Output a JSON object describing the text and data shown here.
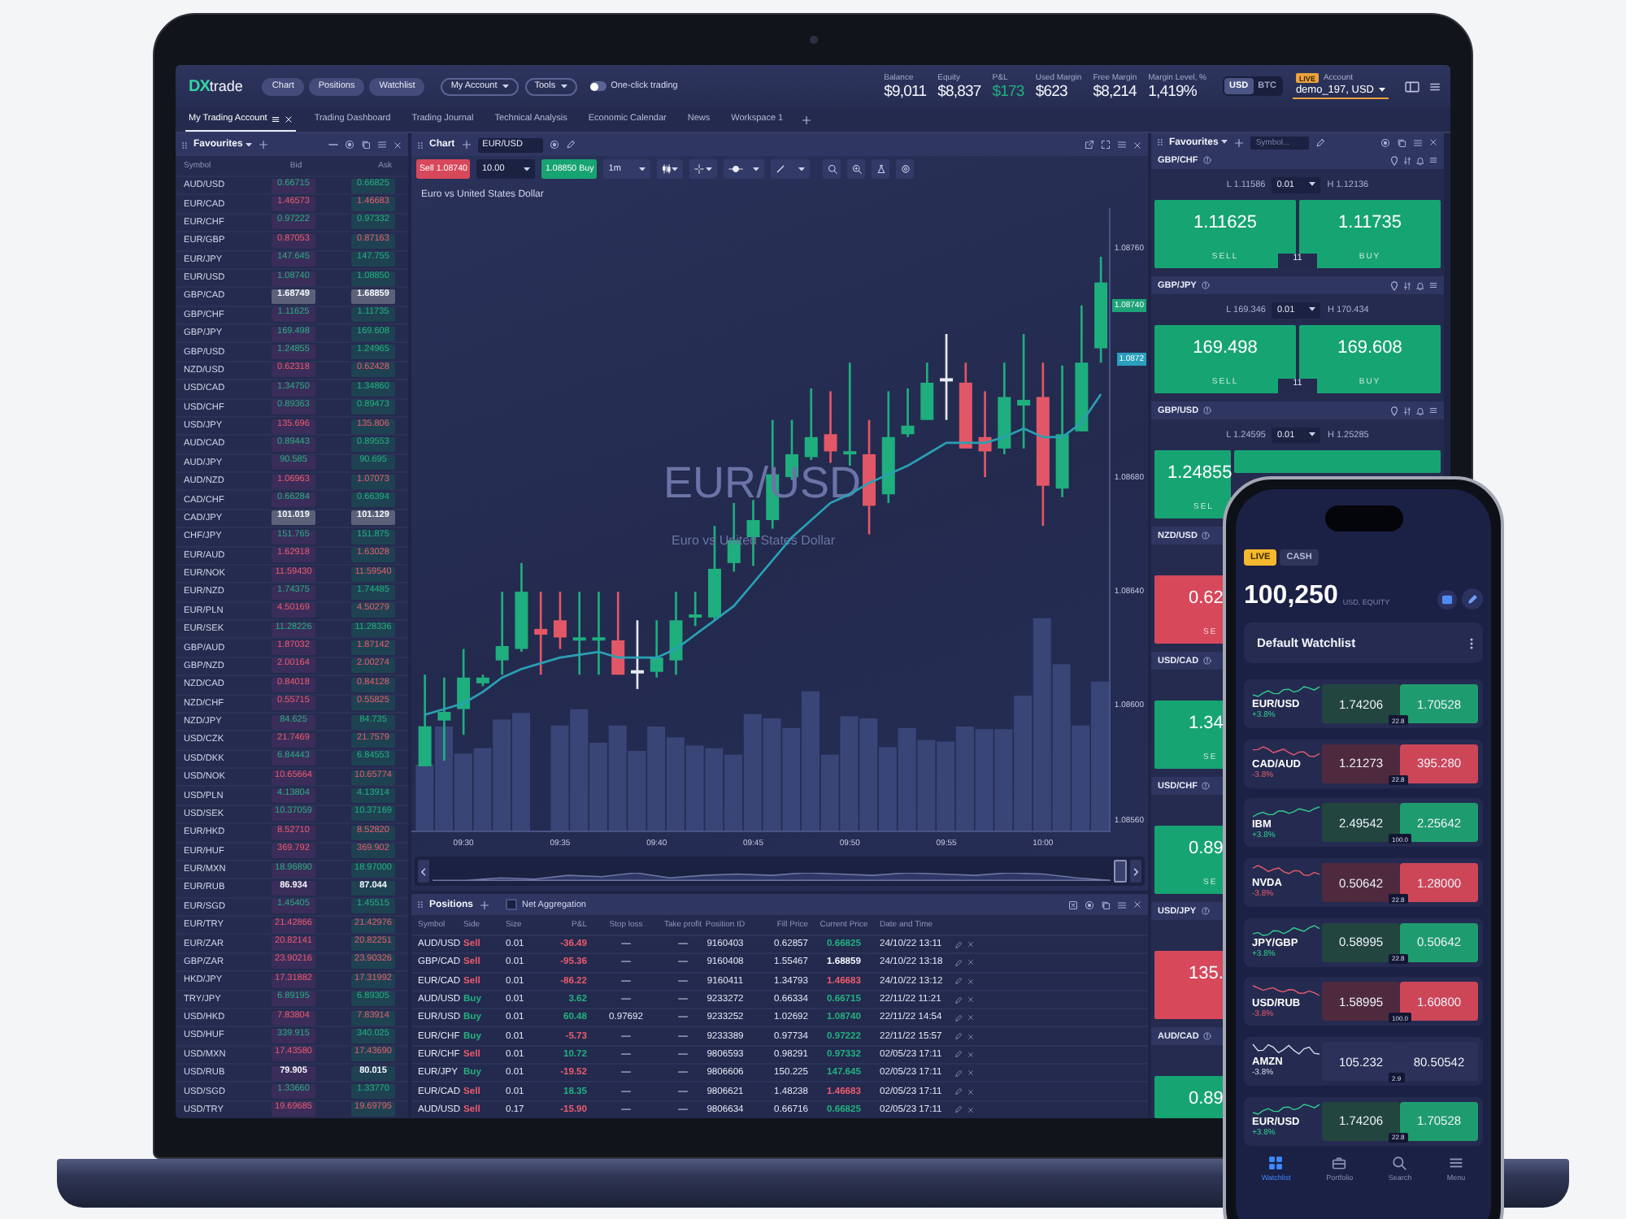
{
  "top_bar": {
    "logo": {
      "mark": "DX",
      "name": "trade"
    },
    "nav_buttons": [
      "Chart",
      "Positions",
      "Watchlist"
    ],
    "menus": [
      "My Account",
      "Tools"
    ],
    "one_click": {
      "label": "One-click trading",
      "on": false
    },
    "stats": [
      {
        "label": "Balance",
        "value": "$9,011",
        "color": "#f4f6fc"
      },
      {
        "label": "Equity",
        "value": "$8,837",
        "color": "#f4f6fc"
      },
      {
        "label": "P&L",
        "value": "$173",
        "color": "#22b07e"
      },
      {
        "label": "Used Margin",
        "value": "$623",
        "color": "#f4f6fc"
      },
      {
        "label": "Free Margin",
        "value": "$8,214",
        "color": "#f4f6fc"
      },
      {
        "label": "Margin Level, %",
        "value": "1,419%",
        "color": "#f4f6fc"
      }
    ],
    "currencies": [
      {
        "label": "USD",
        "selected": true
      },
      {
        "label": "BTC",
        "selected": false
      }
    ],
    "account": {
      "badge": "LIVE",
      "label": "Account",
      "value": "demo_197, USD"
    }
  },
  "tabs": [
    {
      "label": "My Trading Account",
      "selected": true
    },
    {
      "label": "Trading Dashboard",
      "selected": false
    },
    {
      "label": "Trading Journal",
      "selected": false
    },
    {
      "label": "Technical Analysis",
      "selected": false
    },
    {
      "label": "Economic Calendar",
      "selected": false
    },
    {
      "label": "News",
      "selected": false
    },
    {
      "label": "Workspace 1",
      "selected": false
    }
  ],
  "watchlist": {
    "title": "Favourites",
    "columns": [
      "Symbol",
      "Bid",
      "Ask"
    ],
    "rows": [
      {
        "symbol": "AUD/USD",
        "bid": "0.66715",
        "ask": "0.66825",
        "kind": "up",
        "highlighted": false
      },
      {
        "symbol": "EUR/CAD",
        "bid": "1.46573",
        "ask": "1.46683",
        "kind": "down",
        "highlighted": false
      },
      {
        "symbol": "EUR/CHF",
        "bid": "0.97222",
        "ask": "0.97332",
        "kind": "up",
        "highlighted": false
      },
      {
        "symbol": "EUR/GBP",
        "bid": "0.87053",
        "ask": "0.87163",
        "kind": "down",
        "highlighted": false
      },
      {
        "symbol": "EUR/JPY",
        "bid": "147.645",
        "ask": "147.755",
        "kind": "up",
        "highlighted": false
      },
      {
        "symbol": "EUR/USD",
        "bid": "1.08740",
        "ask": "1.08850",
        "kind": "up",
        "highlighted": false
      },
      {
        "symbol": "GBP/CAD",
        "bid": "1.68749",
        "ask": "1.68859",
        "kind": "flat",
        "highlighted": true
      },
      {
        "symbol": "GBP/CHF",
        "bid": "1.11625",
        "ask": "1.11735",
        "kind": "up",
        "highlighted": false
      },
      {
        "symbol": "GBP/JPY",
        "bid": "169.498",
        "ask": "169.608",
        "kind": "up",
        "highlighted": false
      },
      {
        "symbol": "GBP/USD",
        "bid": "1.24855",
        "ask": "1.24965",
        "kind": "up",
        "highlighted": false
      },
      {
        "symbol": "NZD/USD",
        "bid": "0.62318",
        "ask": "0.62428",
        "kind": "down",
        "highlighted": false
      },
      {
        "symbol": "USD/CAD",
        "bid": "1.34750",
        "ask": "1.34860",
        "kind": "up",
        "highlighted": false
      },
      {
        "symbol": "USD/CHF",
        "bid": "0.89363",
        "ask": "0.89473",
        "kind": "up",
        "highlighted": false
      },
      {
        "symbol": "USD/JPY",
        "bid": "135.696",
        "ask": "135.806",
        "kind": "down",
        "highlighted": false
      },
      {
        "symbol": "AUD/CAD",
        "bid": "0.89443",
        "ask": "0.89553",
        "kind": "up",
        "highlighted": false
      },
      {
        "symbol": "AUD/JPY",
        "bid": "90.585",
        "ask": "90.695",
        "kind": "up",
        "highlighted": false
      },
      {
        "symbol": "AUD/NZD",
        "bid": "1.06963",
        "ask": "1.07073",
        "kind": "down",
        "highlighted": false
      },
      {
        "symbol": "CAD/CHF",
        "bid": "0.66284",
        "ask": "0.66394",
        "kind": "up",
        "highlighted": false
      },
      {
        "symbol": "CAD/JPY",
        "bid": "101.019",
        "ask": "101.129",
        "kind": "flat",
        "highlighted": true
      },
      {
        "symbol": "CHF/JPY",
        "bid": "151.765",
        "ask": "151.875",
        "kind": "up",
        "highlighted": false
      },
      {
        "symbol": "EUR/AUD",
        "bid": "1.62918",
        "ask": "1.63028",
        "kind": "down",
        "highlighted": false
      },
      {
        "symbol": "EUR/NOK",
        "bid": "11.59430",
        "ask": "11.59540",
        "kind": "down",
        "highlighted": false
      },
      {
        "symbol": "EUR/NZD",
        "bid": "1.74375",
        "ask": "1.74485",
        "kind": "up",
        "highlighted": false
      },
      {
        "symbol": "EUR/PLN",
        "bid": "4.50169",
        "ask": "4.50279",
        "kind": "down",
        "highlighted": false
      },
      {
        "symbol": "EUR/SEK",
        "bid": "11.28226",
        "ask": "11.28336",
        "kind": "up",
        "highlighted": false
      },
      {
        "symbol": "GBP/AUD",
        "bid": "1.87032",
        "ask": "1.87142",
        "kind": "down",
        "highlighted": false
      },
      {
        "symbol": "GBP/NZD",
        "bid": "2.00164",
        "ask": "2.00274",
        "kind": "down",
        "highlighted": false
      },
      {
        "symbol": "NZD/CAD",
        "bid": "0.84018",
        "ask": "0.84128",
        "kind": "down",
        "highlighted": false
      },
      {
        "symbol": "NZD/CHF",
        "bid": "0.55715",
        "ask": "0.55825",
        "kind": "down",
        "highlighted": false
      },
      {
        "symbol": "NZD/JPY",
        "bid": "84.625",
        "ask": "84.735",
        "kind": "up",
        "highlighted": false
      },
      {
        "symbol": "USD/CZK",
        "bid": "21.7469",
        "ask": "21.7579",
        "kind": "down",
        "highlighted": false
      },
      {
        "symbol": "USD/DKK",
        "bid": "6.84443",
        "ask": "6.84553",
        "kind": "up",
        "highlighted": false
      },
      {
        "symbol": "USD/NOK",
        "bid": "10.65664",
        "ask": "10.65774",
        "kind": "down",
        "highlighted": false
      },
      {
        "symbol": "USD/PLN",
        "bid": "4.13804",
        "ask": "4.13914",
        "kind": "up",
        "highlighted": false
      },
      {
        "symbol": "USD/SEK",
        "bid": "10.37059",
        "ask": "10.37169",
        "kind": "up",
        "highlighted": false
      },
      {
        "symbol": "EUR/HKD",
        "bid": "8.52710",
        "ask": "8.52820",
        "kind": "down",
        "highlighted": false
      },
      {
        "symbol": "EUR/HUF",
        "bid": "369.792",
        "ask": "369.902",
        "kind": "down",
        "highlighted": false
      },
      {
        "symbol": "EUR/MXN",
        "bid": "18.96890",
        "ask": "18.97000",
        "kind": "up",
        "highlighted": false
      },
      {
        "symbol": "EUR/RUB",
        "bid": "86.934",
        "ask": "87.044",
        "kind": "flat",
        "highlighted": false
      },
      {
        "symbol": "EUR/SGD",
        "bid": "1.45405",
        "ask": "1.45515",
        "kind": "up",
        "highlighted": false
      },
      {
        "symbol": "EUR/TRY",
        "bid": "21.42866",
        "ask": "21.42976",
        "kind": "down",
        "highlighted": false
      },
      {
        "symbol": "EUR/ZAR",
        "bid": "20.82141",
        "ask": "20.82251",
        "kind": "down",
        "highlighted": false
      },
      {
        "symbol": "GBP/ZAR",
        "bid": "23.90216",
        "ask": "23.90326",
        "kind": "down",
        "highlighted": false
      },
      {
        "symbol": "HKD/JPY",
        "bid": "17.31882",
        "ask": "17.31992",
        "kind": "down",
        "highlighted": false
      },
      {
        "symbol": "TRY/JPY",
        "bid": "6.89195",
        "ask": "6.89305",
        "kind": "up",
        "highlighted": false
      },
      {
        "symbol": "USD/HKD",
        "bid": "7.83804",
        "ask": "7.83914",
        "kind": "down",
        "highlighted": false
      },
      {
        "symbol": "USD/HUF",
        "bid": "339.915",
        "ask": "340.025",
        "kind": "up",
        "highlighted": false
      },
      {
        "symbol": "USD/MXN",
        "bid": "17.43580",
        "ask": "17.43690",
        "kind": "down",
        "highlighted": false
      },
      {
        "symbol": "USD/RUB",
        "bid": "79.905",
        "ask": "80.015",
        "kind": "flat",
        "highlighted": false
      },
      {
        "symbol": "USD/SGD",
        "bid": "1.33660",
        "ask": "1.33770",
        "kind": "up",
        "highlighted": false
      },
      {
        "symbol": "USD/TRY",
        "bid": "19.69685",
        "ask": "19.69795",
        "kind": "down",
        "highlighted": false
      }
    ]
  },
  "chart": {
    "title": "Chart",
    "symbol": "EUR/USD",
    "sell": {
      "label": "Sell",
      "price": "1.08740"
    },
    "quantity": "10.00",
    "buy": {
      "price": "1.08850",
      "label": "Buy"
    },
    "timeframe": "1m",
    "description": "Euro vs United States Dollar",
    "watermark": {
      "symbol": "EUR/USD",
      "description": "Euro vs United States Dollar"
    },
    "price_badges": [
      {
        "text": "1.08740",
        "kind": "last"
      },
      {
        "text": "1.0872",
        "kind": "average"
      }
    ],
    "chart_data": {
      "type": "candlestick",
      "x": [
        568,
        569,
        570,
        571,
        572,
        573,
        574,
        575,
        576,
        577,
        578,
        579,
        580,
        581,
        582,
        583,
        584,
        585,
        586,
        587,
        588,
        589,
        590,
        591,
        592,
        593,
        594,
        595,
        596,
        597,
        598,
        599,
        600,
        601,
        602,
        603
      ],
      "ohlc": [
        [
          1.08579,
          1.08611,
          1.08579,
          1.08593
        ],
        [
          1.08595,
          1.0861,
          1.08581,
          1.08598
        ],
        [
          1.08599,
          1.0862,
          1.0859,
          1.0861
        ],
        [
          1.08608,
          1.08611,
          1.08607,
          1.0861
        ],
        [
          1.08616,
          1.0864,
          1.08611,
          1.08621
        ],
        [
          1.0862,
          1.0865,
          1.08619,
          1.0864
        ],
        [
          1.08627,
          1.0864,
          1.08611,
          1.08625
        ],
        [
          1.0863,
          1.0864,
          1.0862,
          1.08624
        ],
        [
          1.08623,
          1.0864,
          1.08611,
          1.08624
        ],
        [
          1.08623,
          1.0864,
          1.08611,
          1.08624
        ],
        [
          1.08623,
          1.0864,
          1.08611,
          1.08611
        ],
        [
          1.08612,
          1.0863,
          1.08606,
          1.08612
        ],
        [
          1.08612,
          1.0863,
          1.0861,
          1.08617
        ],
        [
          1.08616,
          1.0864,
          1.08611,
          1.0863
        ],
        [
          1.08631,
          1.0864,
          1.08628,
          1.08632
        ],
        [
          1.08631,
          1.08663,
          1.0863,
          1.08648
        ],
        [
          1.0865,
          1.08671,
          1.08647,
          1.08658
        ],
        [
          1.08659,
          1.08672,
          1.08649,
          1.08665
        ],
        [
          1.08665,
          1.087,
          1.08662,
          1.08681
        ],
        [
          1.0868,
          1.087,
          1.08679,
          1.08688
        ],
        [
          1.08687,
          1.08711,
          1.08686,
          1.08694
        ],
        [
          1.08695,
          1.0871,
          1.08685,
          1.08689
        ],
        [
          1.08688,
          1.0872,
          1.08684,
          1.08689
        ],
        [
          1.08688,
          1.087,
          1.0866,
          1.0867
        ],
        [
          1.08674,
          1.0871,
          1.08671,
          1.08694
        ],
        [
          1.08695,
          1.08711,
          1.08694,
          1.08698
        ],
        [
          1.087,
          1.0872,
          1.087,
          1.08713
        ],
        [
          1.08714,
          1.0873,
          1.087,
          1.08714
        ],
        [
          1.08713,
          1.0872,
          1.0869,
          1.0869
        ],
        [
          1.08694,
          1.0871,
          1.0868,
          1.08689
        ],
        [
          1.0869,
          1.0872,
          1.08688,
          1.08708
        ],
        [
          1.08705,
          1.0873,
          1.0869,
          1.08707
        ],
        [
          1.08708,
          1.0872,
          1.08663,
          1.08677
        ],
        [
          1.08676,
          1.08719,
          1.08673,
          1.08695
        ],
        [
          1.08696,
          1.0874,
          1.08696,
          1.0872
        ],
        [
          1.08725,
          1.08757,
          1.0872,
          1.08748
        ]
      ],
      "series": [
        {
          "type": "line",
          "color": "#2aa0b4",
          "values": [
            1.08597,
            1.08599,
            1.08601,
            1.08605,
            1.0861,
            1.08613,
            1.08615,
            1.08617,
            1.08618,
            1.08619,
            1.08617,
            1.08617,
            1.08617,
            1.0862,
            1.08625,
            1.0863,
            1.08635,
            1.08643,
            1.08651,
            1.08659,
            1.08665,
            1.08671,
            1.08674,
            1.08678,
            1.08681,
            1.08684,
            1.08688,
            1.08692,
            1.08692,
            1.08692,
            1.08694,
            1.08697,
            1.08694,
            1.08694,
            1.08699,
            1.08709
          ]
        }
      ],
      "xlim": [
        567.3,
        603.5
      ],
      "ylim": [
        1.08556,
        1.08774
      ],
      "yticks": [
        {
          "value": 1.0876,
          "label": "1.08760"
        },
        {
          "value": 1.0868,
          "label": "1.08680"
        },
        {
          "value": 1.0864,
          "label": "1.08640"
        },
        {
          "value": 1.086,
          "label": "1.08600"
        },
        {
          "value": 1.0856,
          "label": "1.08560"
        }
      ],
      "xticks": [
        {
          "value": 570,
          "label": "09:30"
        },
        {
          "value": 575,
          "label": "09:35"
        },
        {
          "value": 580,
          "label": "09:40"
        },
        {
          "value": 585,
          "label": "09:45"
        },
        {
          "value": 590,
          "label": "09:50"
        },
        {
          "value": 595,
          "label": "09:55"
        },
        {
          "value": 600,
          "label": "10:00"
        }
      ]
    }
  },
  "positions": {
    "title": "Positions",
    "net_aggregation": {
      "label": "Net Aggregation",
      "checked": false
    },
    "columns": [
      "Symbol",
      "Side",
      "Size",
      "P&L",
      "Stop loss",
      "Take profit",
      "Position ID",
      "Fill Price",
      "Current Price",
      "Date and Time"
    ],
    "rows": [
      {
        "symbol": "AUD/USD",
        "side": {
          "label": "Sell",
          "color": "#ea5b6c"
        },
        "size": "0.01",
        "pnl": {
          "value": "-36.49",
          "color": "#ea5b6c"
        },
        "stop_loss": "—",
        "take_profit": "—",
        "position_id": "9160403",
        "fill_price": "0.62857",
        "current_price": {
          "value": "0.66825",
          "color": "#22b07e"
        },
        "date": "24/10/22 13:11"
      },
      {
        "symbol": "GBP/CAD",
        "side": {
          "label": "Sell",
          "color": "#ea5b6c"
        },
        "size": "0.01",
        "pnl": {
          "value": "-95.36",
          "color": "#ea5b6c"
        },
        "stop_loss": "—",
        "take_profit": "—",
        "position_id": "9160408",
        "fill_price": "1.55467",
        "current_price": {
          "value": "1.68859",
          "color": "#f4f6fc"
        },
        "date": "24/10/22 13:18"
      },
      {
        "symbol": "EUR/CAD",
        "side": {
          "label": "Sell",
          "color": "#ea5b6c"
        },
        "size": "0.01",
        "pnl": {
          "value": "-86.22",
          "color": "#ea5b6c"
        },
        "stop_loss": "—",
        "take_profit": "—",
        "position_id": "9160411",
        "fill_price": "1.34793",
        "current_price": {
          "value": "1.46683",
          "color": "#ea5b6c"
        },
        "date": "24/10/22 13:12"
      },
      {
        "symbol": "AUD/USD",
        "side": {
          "label": "Buy",
          "color": "#22b07e"
        },
        "size": "0.01",
        "pnl": {
          "value": "3.62",
          "color": "#22b07e"
        },
        "stop_loss": "—",
        "take_profit": "—",
        "position_id": "9233272",
        "fill_price": "0.66334",
        "current_price": {
          "value": "0.66715",
          "color": "#22b07e"
        },
        "date": "22/11/22 11:21"
      },
      {
        "symbol": "EUR/USD",
        "side": {
          "label": "Buy",
          "color": "#22b07e"
        },
        "size": "0.01",
        "pnl": {
          "value": "60.48",
          "color": "#22b07e"
        },
        "stop_loss": "0.97692",
        "take_profit": "—",
        "position_id": "9233252",
        "fill_price": "1.02692",
        "current_price": {
          "value": "1.08740",
          "color": "#22b07e"
        },
        "date": "22/11/22 14:54"
      },
      {
        "symbol": "EUR/CHF",
        "side": {
          "label": "Buy",
          "color": "#22b07e"
        },
        "size": "0.01",
        "pnl": {
          "value": "-5.73",
          "color": "#ea5b6c"
        },
        "stop_loss": "—",
        "take_profit": "—",
        "position_id": "9233389",
        "fill_price": "0.97734",
        "current_price": {
          "value": "0.97222",
          "color": "#22b07e"
        },
        "date": "22/11/22 15:57"
      },
      {
        "symbol": "EUR/CHF",
        "side": {
          "label": "Sell",
          "color": "#ea5b6c"
        },
        "size": "0.01",
        "pnl": {
          "value": "10.72",
          "color": "#22b07e"
        },
        "stop_loss": "—",
        "take_profit": "—",
        "position_id": "9806593",
        "fill_price": "0.98291",
        "current_price": {
          "value": "0.97332",
          "color": "#22b07e"
        },
        "date": "02/05/23 17:11"
      },
      {
        "symbol": "EUR/JPY",
        "side": {
          "label": "Buy",
          "color": "#22b07e"
        },
        "size": "0.01",
        "pnl": {
          "value": "-19.52",
          "color": "#ea5b6c"
        },
        "stop_loss": "—",
        "take_profit": "—",
        "position_id": "9806606",
        "fill_price": "150.225",
        "current_price": {
          "value": "147.645",
          "color": "#22b07e"
        },
        "date": "02/05/23 17:11"
      },
      {
        "symbol": "EUR/CAD",
        "side": {
          "label": "Sell",
          "color": "#ea5b6c"
        },
        "size": "0.01",
        "pnl": {
          "value": "18.35",
          "color": "#22b07e"
        },
        "stop_loss": "—",
        "take_profit": "—",
        "position_id": "9806621",
        "fill_price": "1.48238",
        "current_price": {
          "value": "1.46683",
          "color": "#ea5b6c"
        },
        "date": "02/05/23 17:11"
      },
      {
        "symbol": "AUD/USD",
        "side": {
          "label": "Sell",
          "color": "#ea5b6c"
        },
        "size": "0.17",
        "pnl": {
          "value": "-15.90",
          "color": "#ea5b6c"
        },
        "stop_loss": "—",
        "take_profit": "—",
        "position_id": "9806634",
        "fill_price": "0.66716",
        "current_price": {
          "value": "0.66825",
          "color": "#22b07e"
        },
        "date": "02/05/23 17:11"
      }
    ]
  },
  "trade_panel": {
    "title": "Favourites",
    "search_placeholder": "Symbol...",
    "cards": [
      {
        "kind": "full",
        "symbol": "GBP/CHF",
        "low": "L 1.11586",
        "quantity": "0.01",
        "high": "H 1.12136",
        "sell_price": "1.11625",
        "sell_label": "SELL",
        "spread": "11",
        "buy_price": "1.11735",
        "buy_label": "BUY",
        "color": "#17a473"
      },
      {
        "kind": "full",
        "symbol": "GBP/JPY",
        "low": "L 169.346",
        "quantity": "0.01",
        "high": "H 170.434",
        "sell_price": "169.498",
        "sell_label": "SELL",
        "spread": "11",
        "buy_price": "169.608",
        "buy_label": "BUY",
        "color": "#17a473"
      },
      {
        "kind": "top",
        "symbol": "GBP/USD",
        "low": "L 1.24595",
        "quantity": "0.01",
        "high": "H 1.25285",
        "sell_price": "1.24855",
        "sell_label": "SEL",
        "color": "#17a473"
      },
      {
        "kind": "partial",
        "symbol": "NZD/USD",
        "sell_price": "0.62",
        "sell_label": "SE",
        "color": "#d7485b"
      },
      {
        "kind": "partial",
        "symbol": "USD/CAD",
        "sell_price": "1.34",
        "sell_label": "SE",
        "color": "#17a473"
      },
      {
        "kind": "partial",
        "symbol": "USD/CHF",
        "sell_price": "0.89",
        "sell_label": "SE",
        "color": "#17a473"
      },
      {
        "kind": "partial",
        "symbol": "USD/JPY",
        "sell_price": "135.",
        "color": "#d7485b"
      },
      {
        "kind": "partial",
        "symbol": "AUD/CAD",
        "sell_price": "0.89",
        "color": "#17a473"
      }
    ]
  },
  "phone": {
    "modes": [
      {
        "label": "LIVE",
        "selected": true
      },
      {
        "label": "CASH",
        "selected": false
      }
    ],
    "equity": "100,250",
    "equity_label": "USD, EQUITY",
    "watchlist_title": "Default Watchlist",
    "rows": [
      {
        "symbol": "EUR/USD",
        "change": "+3.8%",
        "bid": "1.74206",
        "ask": "1.70528",
        "spread": "22.8",
        "kind": "up"
      },
      {
        "symbol": "CAD/AUD",
        "change": "-3.8%",
        "bid": "1.21273",
        "ask": "395.280",
        "spread": "22.8",
        "kind": "down"
      },
      {
        "symbol": "IBM",
        "change": "+3.8%",
        "bid": "2.49542",
        "ask": "2.25642",
        "spread": "100.0",
        "kind": "up"
      },
      {
        "symbol": "NVDA",
        "change": "-3.8%",
        "bid": "0.50642",
        "ask": "1.28000",
        "spread": "22.8",
        "kind": "down"
      },
      {
        "symbol": "JPY/GBP",
        "change": "+3.8%",
        "bid": "0.58995",
        "ask": "0.50642",
        "spread": "22.8",
        "kind": "up"
      },
      {
        "symbol": "USD/RUB",
        "change": "-3.8%",
        "bid": "1.58995",
        "ask": "1.60800",
        "spread": "100.0",
        "kind": "down"
      },
      {
        "symbol": "AMZN",
        "change": "-3.8%",
        "bid": "105.232",
        "ask": "80.50542",
        "spread": "2.9",
        "kind": "flat"
      },
      {
        "symbol": "EUR/USD",
        "change": "+3.8%",
        "bid": "1.74206",
        "ask": "1.70528",
        "spread": "22.8",
        "kind": "up"
      }
    ],
    "nav": [
      {
        "label": "Watchlist",
        "selected": true
      },
      {
        "label": "Portfolio",
        "selected": false
      },
      {
        "label": "Search",
        "selected": false
      },
      {
        "label": "Menu",
        "selected": false
      }
    ]
  }
}
